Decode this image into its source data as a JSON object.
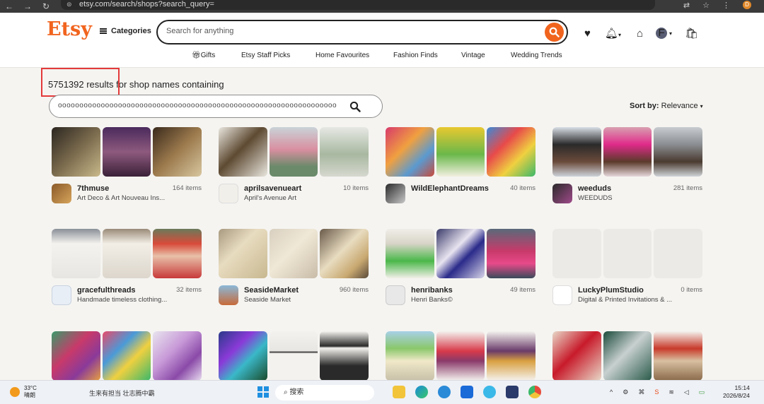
{
  "browser": {
    "url": "etsy.com/search/shops?search_query=",
    "profile_badge": "D"
  },
  "header": {
    "logo": "Etsy",
    "categories_label": "Categories",
    "search_placeholder": "Search for anything",
    "nav": [
      "Gifts",
      "Etsy Staff Picks",
      "Home Favourites",
      "Fashion Finds",
      "Vintage",
      "Wedding Trends"
    ],
    "avatar_initial": "F",
    "brand_color": "#f1641e"
  },
  "results": {
    "count": "5751392 results",
    "suffix": " for shop names containing",
    "query": "ooooooooooooooooooooooooooooooooooooooooooooooooooooooooooooooooo",
    "sort_label": "Sort by:",
    "sort_value": "Relevance"
  },
  "shops": [
    {
      "name": "7thmuse",
      "sub": "Art Deco & Art Nouveau Ins...",
      "items": "164 items"
    },
    {
      "name": "aprilsavenueart",
      "sub": "April's Avenue Art",
      "items": "10 items"
    },
    {
      "name": "WildElephantDreams",
      "sub": "",
      "items": "40 items"
    },
    {
      "name": "weeduds",
      "sub": "WEEDUDS",
      "items": "281 items"
    },
    {
      "name": "gracefulthreads",
      "sub": "Handmade timeless clothing...",
      "items": "32 items"
    },
    {
      "name": "SeasideMarket",
      "sub": "Seaside Market",
      "items": "960 items"
    },
    {
      "name": "henribanks",
      "sub": "Henri Banks©",
      "items": "49 items"
    },
    {
      "name": "LuckyPlumStudio",
      "sub": "Digital & Printed Invitations & ...",
      "items": "0 items"
    },
    {
      "name": "",
      "sub": "",
      "items": ""
    },
    {
      "name": "",
      "sub": "",
      "items": ""
    },
    {
      "name": "",
      "sub": "",
      "items": ""
    },
    {
      "name": "",
      "sub": "",
      "items": ""
    }
  ],
  "taskbar": {
    "temp": "33°C",
    "weather": "晴朗",
    "news": "生来有担当 壮志腾中霸",
    "search": "搜索",
    "time": "15:14",
    "date": "2026/8/24"
  }
}
